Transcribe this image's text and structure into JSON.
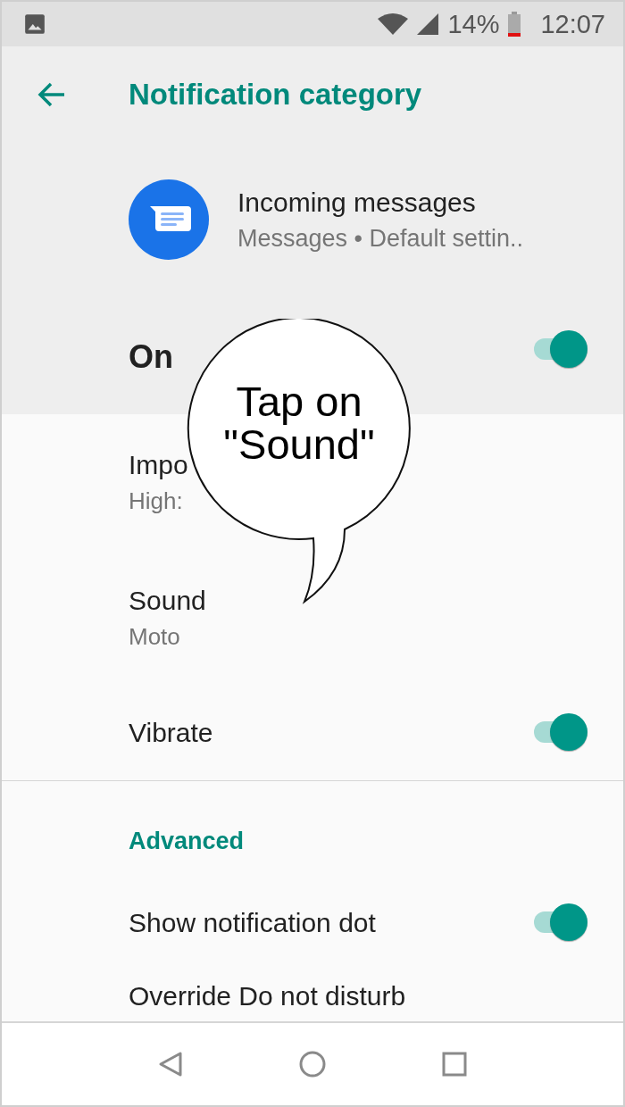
{
  "status_bar": {
    "battery": "14%",
    "time": "12:07"
  },
  "toolbar": {
    "title": "Notification category"
  },
  "app": {
    "name": "Incoming messages",
    "subtitle": "Messages • Default settin.."
  },
  "master": {
    "label": "On",
    "on": true
  },
  "settings": [
    {
      "kind": "text",
      "title": "Impo",
      "summary": "High:"
    },
    {
      "kind": "text",
      "title": "Sound",
      "summary": "Moto"
    },
    {
      "kind": "switch",
      "title": "Vibrate",
      "on": true
    }
  ],
  "advanced": {
    "header": "Advanced",
    "items": [
      {
        "kind": "switch",
        "title": "Show notification dot",
        "on": true
      },
      {
        "kind": "text",
        "title": "Override Do not disturb"
      }
    ]
  },
  "callout": {
    "text": "Tap on \"Sound\""
  }
}
